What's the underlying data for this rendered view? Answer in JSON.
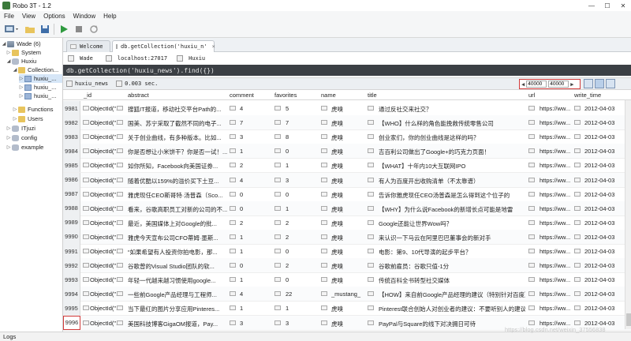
{
  "window": {
    "title": "Robo 3T - 1.2",
    "minimize": "—",
    "maximize": "☐",
    "close": "✕"
  },
  "menu": [
    "File",
    "View",
    "Options",
    "Window",
    "Help"
  ],
  "tree": {
    "server": "Wade (6)",
    "system": "System",
    "huxiu": "Huxiu",
    "collections": "Collection...",
    "coll_items": [
      "huxiu_...",
      "huxiu_...",
      "huxiu_..."
    ],
    "functions": "Functions",
    "users": "Users",
    "itjuzi": "ITjuzi",
    "config": "config",
    "example": "example"
  },
  "tabs": {
    "welcome": "Welcome",
    "query": "db.getCollection('huxiu_n'",
    "close": "×"
  },
  "info": {
    "user": "Wade",
    "host": "localhost:27017",
    "db": "Huxiu"
  },
  "query": {
    "text": "db.getCollection('huxiu_news').find({})"
  },
  "result": {
    "collection": "huxiu_news",
    "time": "0.003 sec.",
    "page_from": "40000",
    "page_to": "40000"
  },
  "columns": [
    "_id",
    "abstract",
    "comment",
    "favorites",
    "name",
    "title",
    "url",
    "write_time"
  ],
  "rows": [
    {
      "n": "9981",
      "id": "ObjectId(\"...",
      "abstract": "搜狐IT报道，移动社交平台Path的...",
      "comment": "4",
      "fav": "5",
      "name": "虎嗅",
      "title": "通过反社交来社交？",
      "url": "https://ww...",
      "time": "2012-04-03"
    },
    {
      "n": "9982",
      "id": "ObjectId(\"...",
      "abstract": "国美、苏宁采取了截然不同的电子...",
      "comment": "7",
      "fav": "7",
      "name": "虎嗅",
      "title": "【WHO】什么样的角色能挽救传统零售公司",
      "url": "https://ww...",
      "time": "2012-04-03"
    },
    {
      "n": "9983",
      "id": "ObjectId(\"...",
      "abstract": "关于创业曲线，有多种版本。比如...",
      "comment": "3",
      "fav": "8",
      "name": "虎嗅",
      "title": "创业家们，你的创业曲线是这样的吗？",
      "url": "https://ww...",
      "time": "2012-04-03"
    },
    {
      "n": "9984",
      "id": "ObjectId(\"...",
      "abstract": "你是否想让小米饼干？你是否一试！...",
      "comment": "1",
      "fav": "0",
      "name": "虎嗅",
      "title": "吉百利公司做出了Google+的巧克力页面！",
      "url": "https://ww...",
      "time": "2012-04-03"
    },
    {
      "n": "9985",
      "id": "ObjectId(\"...",
      "abstract": "如你所知，Facebook向美国证券...",
      "comment": "2",
      "fav": "1",
      "name": "虎嗅",
      "title": "【WHAT】十年内10大互联网IPO",
      "url": "https://ww...",
      "time": "2012-04-03"
    },
    {
      "n": "9986",
      "id": "ObjectId(\"...",
      "abstract": "随着优酷以159%的溢价买下土豆...",
      "comment": "4",
      "fav": "3",
      "name": "虎嗅",
      "title": "有人为百度开出收购清单（不太靠谱）",
      "url": "https://ww...",
      "time": "2012-04-03"
    },
    {
      "n": "9987",
      "id": "ObjectId(\"...",
      "abstract": "雅虎现任CEO斯哥特·汤普森（Sco...",
      "comment": "0",
      "fav": "0",
      "name": "虎嗅",
      "title": "告诉你雅虎现任CEO汤普森是怎么得到这个位子的",
      "url": "https://ww...",
      "time": "2012-04-03"
    },
    {
      "n": "9988",
      "id": "ObjectId(\"...",
      "abstract": "看来，谷歌高职员工对新的公司的不...",
      "comment": "0",
      "fav": "1",
      "name": "虎嗅",
      "title": "【WHY】为什么说Facebook的新增长点可能是地雷",
      "url": "https://ww...",
      "time": "2012-04-03"
    },
    {
      "n": "9989",
      "id": "ObjectId(\"...",
      "abstract": "最近，美国媒体上对Google的批...",
      "comment": "2",
      "fav": "2",
      "name": "虎嗅",
      "title": "Google还能让世界Wow吗？",
      "url": "https://ww...",
      "time": "2012-04-03"
    },
    {
      "n": "9990",
      "id": "ObjectId(\"...",
      "abstract": "雅虎今天宣布公司CFO蒂姆·墨斯...",
      "comment": "1",
      "fav": "2",
      "name": "虎嗅",
      "title": "来认识一下马云在阿里巴巴董事会的新对手",
      "url": "https://ww...",
      "time": "2012-04-03"
    },
    {
      "n": "9991",
      "id": "ObjectId(\"...",
      "abstract": "“如果希望有人投资你拍电影，那...",
      "comment": "1",
      "fav": "0",
      "name": "虎嗅",
      "title": "电影：第9、10代导演的起步平台？",
      "url": "https://ww...",
      "time": "2012-04-03"
    },
    {
      "n": "9992",
      "id": "ObjectId(\"...",
      "abstract": "谷歌曾的Visual Studio团队的软...",
      "comment": "0",
      "fav": "2",
      "name": "虎嗅",
      "title": "谷歌前雇员：谷歌只值-1分",
      "url": "https://ww...",
      "time": "2012-04-03"
    },
    {
      "n": "9993",
      "id": "ObjectId(\"...",
      "abstract": "年轻一代越来越习惯使用google...",
      "comment": "1",
      "fav": "0",
      "name": "虎嗅",
      "title": "传统百科全书转型社交媒体",
      "url": "https://ww...",
      "time": "2012-04-03"
    },
    {
      "n": "9994",
      "id": "ObjectId(\"...",
      "abstract": "一些前Google产品经理与工程师...",
      "comment": "4",
      "fav": "22",
      "name": "_mustang_",
      "title": "【HOW】来自前Google产品经理的建议（特别针对百度）",
      "url": "https://ww...",
      "time": "2012-04-03"
    },
    {
      "n": "9995",
      "id": "ObjectId(\"...",
      "abstract": "当下最红的图片分享应用Pinteres...",
      "comment": "1",
      "fav": "1",
      "name": "虎嗅",
      "title": "Pinterest联合创始人对创业者的建议：不要听别人的建议！",
      "url": "https://ww...",
      "time": "2012-04-03"
    },
    {
      "n": "9996",
      "id": "ObjectId(\"...",
      "abstract": "美国科技博客GigaOM报道，Pay...",
      "comment": "3",
      "fav": "3",
      "name": "虎嗅",
      "title": "PayPal与Square的线下对决拥日可待",
      "url": "https://ww...",
      "time": "2012-04-03"
    }
  ],
  "status": {
    "logs": "Logs"
  },
  "watermark": "https://blog.csdn.net/weixin_37556838"
}
